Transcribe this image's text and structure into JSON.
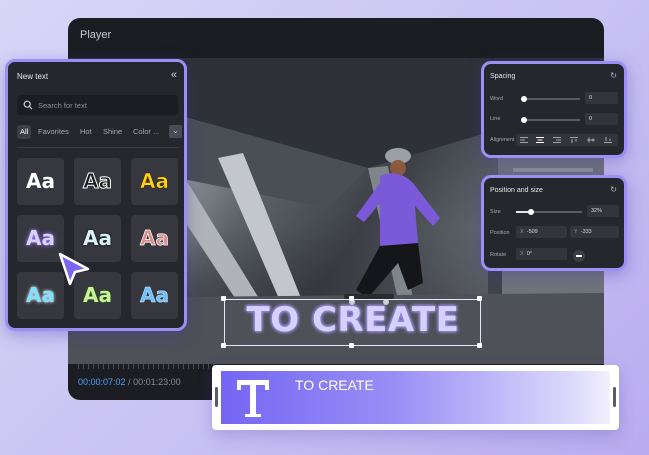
{
  "player": {
    "title": "Player",
    "timecode_current": "00:00:07:02",
    "timecode_total": "/ 00:01:23:00"
  },
  "new_text": {
    "title": "New text",
    "search_placeholder": "Search for text",
    "tabs": [
      "All",
      "Favorites",
      "Hot",
      "Shine",
      "Color ..."
    ],
    "active_tab": "All",
    "tile_label": "Aa",
    "styles": [
      "plain-white",
      "outline-black",
      "yellow",
      "purple-glow",
      "light-cyan",
      "red-outline",
      "cyan-glow",
      "lime",
      "blue-outline"
    ]
  },
  "spacing": {
    "title": "Spacing",
    "word_label": "Word",
    "word_value": "0",
    "line_label": "Line",
    "line_value": "0",
    "alignment_label": "Alignment"
  },
  "position_size": {
    "title": "Position and size",
    "size_label": "Size",
    "size_value": "32%",
    "size_fraction": 0.22,
    "position_label": "Position",
    "x_axis": "X",
    "x_value": "-509",
    "y_axis": "Y",
    "y_value": "-333",
    "rotate_label": "Rotate",
    "rotate_axis": "X",
    "rotate_value": "0°"
  },
  "caption": {
    "text": "TO CREATE"
  },
  "track": {
    "label": "TO CREATE"
  },
  "colors": {
    "accent": "#9b8ff5",
    "panel_bg": "#26272d",
    "timecode_blue": "#4aa2ff"
  }
}
